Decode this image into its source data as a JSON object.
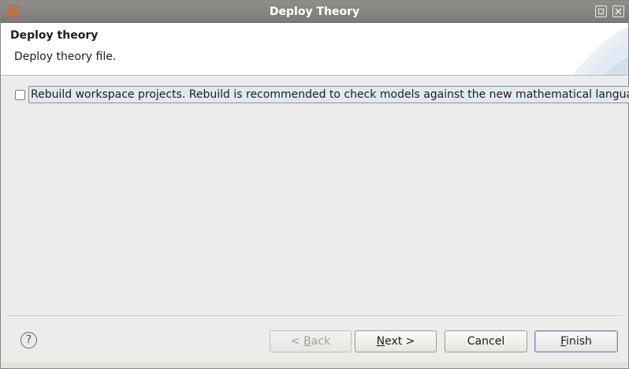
{
  "window": {
    "title": "Deploy Theory",
    "app_icon": "R",
    "controls": [
      "maximize-icon",
      "close-icon"
    ]
  },
  "header": {
    "title": "Deploy theory",
    "description": "Deploy theory file."
  },
  "options": {
    "rebuild_label": "Rebuild workspace projects. Rebuild is recommended to check models against the new mathematical language.",
    "rebuild_checked": false
  },
  "footer": {
    "help_label": "?",
    "back_prefix": "< ",
    "back_mnemonic": "B",
    "back_rest": "ack",
    "next_mnemonic": "N",
    "next_rest": "ext >",
    "cancel_label": "Cancel",
    "finish_mnemonic": "F",
    "finish_rest": "inish"
  },
  "colors": {
    "titlebar": "#7c7b77",
    "focus_border": "#7a96bd",
    "app_icon": "#e0622a"
  }
}
